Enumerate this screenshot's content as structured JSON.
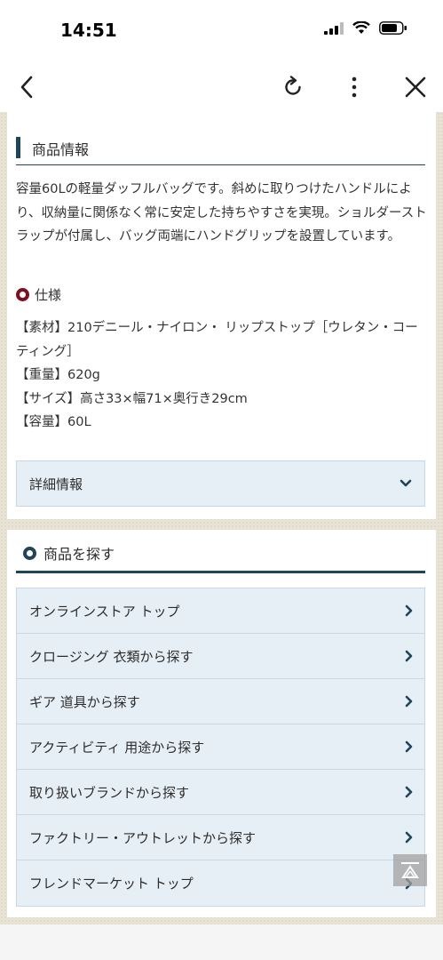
{
  "status": {
    "time": "14:51"
  },
  "product_info": {
    "title": "商品情報",
    "description": "容量60Lの軽量ダッフルバッグです。斜めに取りつけたハンドルにより、収納量に関係なく常に安定した持ちやすさを実現。ショルダーストラップが付属し、バッグ両端にハンドグリップを設置しています。",
    "spec_label": "仕様",
    "specs": [
      "【素材】210デニール・ナイロン・ リップストップ［ウレタン・コーティング］",
      "【重量】620g",
      "【サイズ】高さ33×幅71×奥行き29cm",
      "【容量】60L"
    ],
    "detail_label": "詳細情報"
  },
  "search": {
    "title": "商品を探す",
    "items": [
      {
        "label": "オンラインストア トップ"
      },
      {
        "label": "クロージング 衣類から探す"
      },
      {
        "label": "ギア 道具から探す"
      },
      {
        "label": "アクティビティ 用途から探す"
      },
      {
        "label": "取り扱いブランドから探す"
      },
      {
        "label": "ファクトリー・アウトレットから探す"
      },
      {
        "label": "フレンドマーケット トップ"
      }
    ]
  },
  "icons": {
    "back": "back-chevron-icon",
    "reload": "reload-icon",
    "more": "more-vertical-icon",
    "close": "close-icon",
    "chevron_down": "chevron-down-icon",
    "chevron_right": "chevron-right-icon",
    "scroll_top": "scroll-to-top-icon"
  },
  "colors": {
    "accent": "#1f4559",
    "spec_dot": "#7a1020",
    "menu_bg": "#e7eff6"
  }
}
